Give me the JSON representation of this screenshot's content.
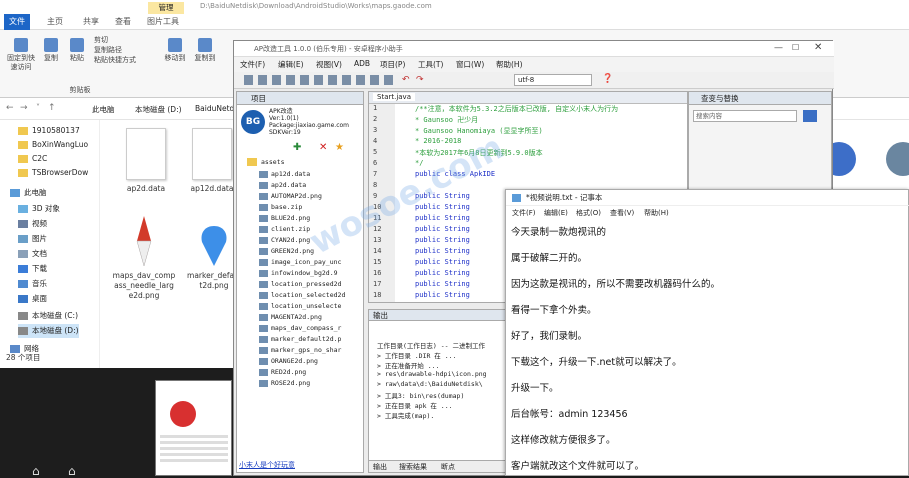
{
  "explorer": {
    "title_path": "D:\\BaiduNetdisk\\Download\\AndroidStudio\\Works\\maps.gaode.com",
    "tabs": [
      "文件",
      "主页",
      "共享",
      "查看",
      "图片工具"
    ],
    "manage_tab": "管理",
    "ribbon": {
      "pin": "固定到快速访问",
      "copy": "复制",
      "paste": "粘贴",
      "cut": "剪切",
      "copy_path": "复制路径",
      "paste_shortcut": "粘贴快捷方式",
      "move_to": "移动到",
      "copy_to": "复制到",
      "clipboard": "剪贴板"
    },
    "address": [
      "此电脑",
      "本地磁盘 (D:)",
      "BaiduNetdisk"
    ],
    "nav_items": [
      "1910580137",
      "BoXinWangLuo",
      "C2C",
      "TSBrowserDow",
      "此电脑",
      "3D 对象",
      "视频",
      "图片",
      "文档",
      "下载",
      "音乐",
      "桌面",
      "本地磁盘 (C:)",
      "本地磁盘 (D:)",
      "网络"
    ],
    "files": [
      {
        "name": "ap2d.data",
        "type": "doc"
      },
      {
        "name": "ap12d.data",
        "type": "doc"
      },
      {
        "name": "maps_dav_compass_needle_large2d.png",
        "type": "compass"
      },
      {
        "name": "marker_default2d.png",
        "type": "marker"
      }
    ],
    "status": "28 个项目"
  },
  "ide": {
    "title": "AP改造工具 1.0.0 (伯乐专用) - 安卓程序小助手",
    "menus": [
      "文件(F)",
      "编辑(E)",
      "视图(V)",
      "ADB",
      "项目(P)",
      "工具(T)",
      "窗口(W)",
      "帮助(H)"
    ],
    "encoding": "utf-8",
    "project_panel_title": "项目",
    "project_info": [
      "APK改造",
      "Ver:1.0(1)",
      "Package:jiaxiao.game.com",
      "SDKVer:19"
    ],
    "tree": [
      "assets",
      "ap12d.data",
      "ap2d.data",
      "AUTOMAP2d.png",
      "base.zip",
      "BLUE2d.png",
      "client.zip",
      "CYAN2d.png",
      "GREEN2d.png",
      "image_icon_pay_unc",
      "infowindow_bg2d.9",
      "location_pressed2d",
      "location_selected2d",
      "location_unselecte",
      "MAGENTA2d.png",
      "maps_dav_compass_r",
      "marker_default2d.p",
      "marker_gps_no_shar",
      "ORANGE2d.png",
      "RED2d.png",
      "ROSE2d.png"
    ],
    "editor_tab": "Start.java",
    "line_numbers": [
      "1",
      "2",
      "3",
      "4",
      "5",
      "6",
      "7",
      "8",
      "9",
      "10",
      "11",
      "12",
      "13",
      "14",
      "15",
      "16",
      "17",
      "18"
    ],
    "code_lines": [
      {
        "text": "/**注意，本软件为5.3.2之后版本已改版, 自定义小末人为行为",
        "cls": "cm"
      },
      {
        "text": " * Gaunsoo 卍少月",
        "cls": "cm"
      },
      {
        "text": " * Gaunsoo Hanomiaya (显显字所至)",
        "cls": "cm"
      },
      {
        "text": " * 2016-2018",
        "cls": "cm"
      },
      {
        "text": " *本软为2017年6月8日更新到5.9.0版本",
        "cls": "cm"
      },
      {
        "text": " */",
        "cls": "cm"
      },
      {
        "text": "public class ApkIDE",
        "cls": "kw"
      },
      {
        "text": "",
        "cls": ""
      },
      {
        "text": "    public String",
        "cls": "kw"
      },
      {
        "text": "    public String",
        "cls": "kw"
      },
      {
        "text": "    public String",
        "cls": "kw"
      },
      {
        "text": "    public String",
        "cls": "kw"
      },
      {
        "text": "    public String",
        "cls": "kw"
      },
      {
        "text": "    public String",
        "cls": "kw"
      },
      {
        "text": "    public String",
        "cls": "kw"
      },
      {
        "text": "    public String",
        "cls": "kw"
      },
      {
        "text": "    public String",
        "cls": "kw"
      },
      {
        "text": "    public String",
        "cls": "kw"
      }
    ],
    "output_title": "输出",
    "output_lines": [
      "工作目录(工作日志) -- 二进制工作",
      "> 工作目录 .DIR 在 ... ",
      "> 正在准备开始 ...",
      ">  res\\drawable-hdpi\\icon.png",
      ">  raw\\data\\d:\\BaiduNetdisk\\",
      "> 工具3: bin\\res(dumap)",
      "> 正在目录 apk 在 ...",
      "> 工具完成(map)."
    ],
    "output_tabs": [
      "输出",
      "搜索结果",
      "断点"
    ],
    "resource_panel_title": "查变与替换",
    "resource_search_placeholder": "搜索内容",
    "footer_link": "小末人是个好玩意"
  },
  "notepad": {
    "title": "*视频说明.txt - 记事本",
    "menus": [
      "文件(F)",
      "编辑(E)",
      "格式(O)",
      "查看(V)",
      "帮助(H)"
    ],
    "lines": [
      "今天录制一款炮视讯的",
      "属于破解二开的。",
      "因为这款是视讯的，所以不需要改机器码什么的。",
      "看得一下拿个外卖。",
      "好了，我们录制。",
      "下载这个，升级一下.net就可以解决了。",
      "升级一下。",
      "后台帐号：admin      123456",
      "这样修改就方便很多了。",
      "客户端就改这个文件就可以了。"
    ]
  }
}
